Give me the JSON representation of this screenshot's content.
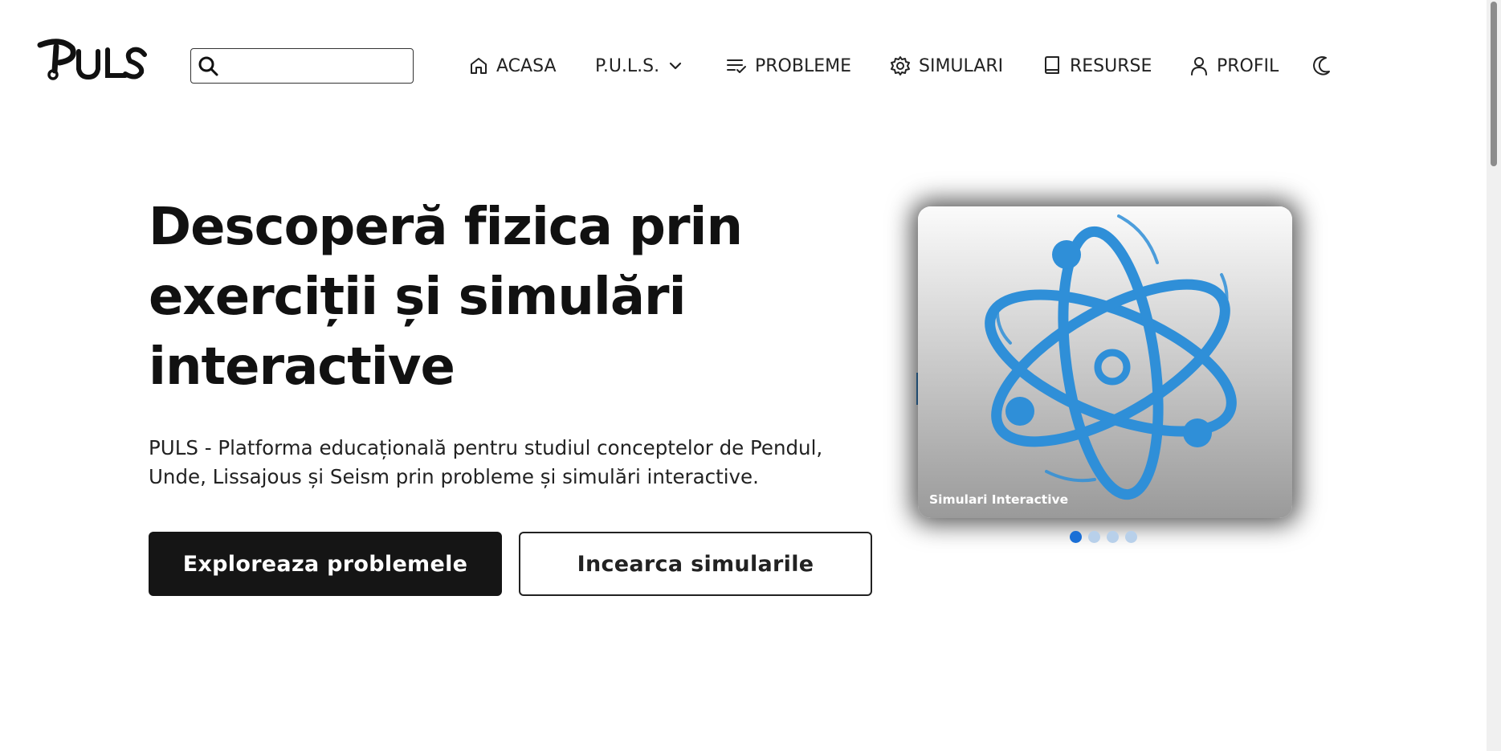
{
  "header": {
    "logo_text": "PULS",
    "search": {
      "placeholder": "",
      "value": ""
    },
    "nav": [
      {
        "label": "ACASA",
        "icon": "home-icon"
      },
      {
        "label": "P.U.L.S.",
        "icon": "chevron-down-icon"
      },
      {
        "label": "PROBLEME",
        "icon": "list-check-icon"
      },
      {
        "label": "SIMULARI",
        "icon": "gear-icon"
      },
      {
        "label": "RESURSE",
        "icon": "book-icon"
      },
      {
        "label": "PROFIL",
        "icon": "user-icon"
      }
    ],
    "theme_toggle_icon": "moon-icon"
  },
  "hero": {
    "title_lines": [
      "Descoperă fizica prin",
      "exerciții și simulări",
      "interactive"
    ],
    "description_lines": [
      "PULS - Platforma educațională pentru studiul conceptelor de Pendul,",
      "Unde, Lissajous și Seism prin probleme și simulări interactive."
    ],
    "primary_button": "Exploreaza problemele",
    "secondary_button": "Incearca simularile"
  },
  "carousel": {
    "caption": "Simulari Interactive",
    "image_icon": "atom-icon",
    "slide_count": 4,
    "active_slide": 1
  },
  "colors": {
    "accent": "#1a6fd6",
    "atom": "#2f8fd8",
    "primary_button_bg": "#151515",
    "text": "#111111"
  }
}
